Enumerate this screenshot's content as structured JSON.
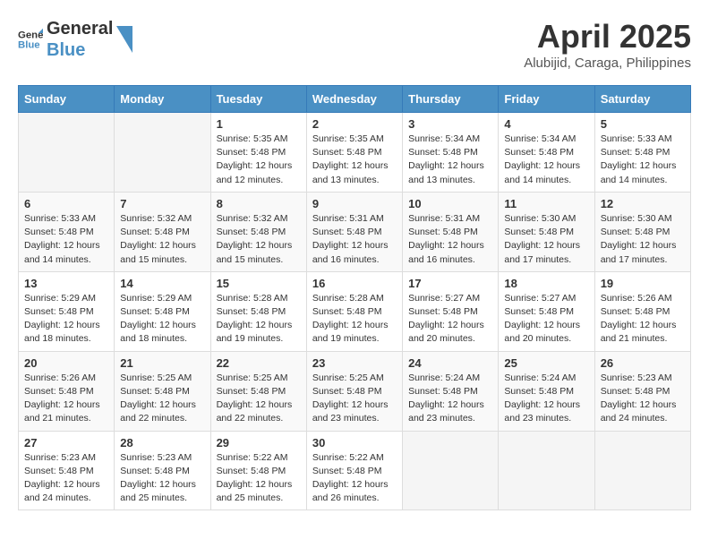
{
  "logo": {
    "line1": "General",
    "line2": "Blue"
  },
  "title": "April 2025",
  "location": "Alubijid, Caraga, Philippines",
  "days_of_week": [
    "Sunday",
    "Monday",
    "Tuesday",
    "Wednesday",
    "Thursday",
    "Friday",
    "Saturday"
  ],
  "weeks": [
    [
      null,
      null,
      {
        "num": "1",
        "sunrise": "5:35 AM",
        "sunset": "5:48 PM",
        "daylight": "12 hours and 12 minutes."
      },
      {
        "num": "2",
        "sunrise": "5:35 AM",
        "sunset": "5:48 PM",
        "daylight": "12 hours and 13 minutes."
      },
      {
        "num": "3",
        "sunrise": "5:34 AM",
        "sunset": "5:48 PM",
        "daylight": "12 hours and 13 minutes."
      },
      {
        "num": "4",
        "sunrise": "5:34 AM",
        "sunset": "5:48 PM",
        "daylight": "12 hours and 14 minutes."
      },
      {
        "num": "5",
        "sunrise": "5:33 AM",
        "sunset": "5:48 PM",
        "daylight": "12 hours and 14 minutes."
      }
    ],
    [
      {
        "num": "6",
        "sunrise": "5:33 AM",
        "sunset": "5:48 PM",
        "daylight": "12 hours and 14 minutes."
      },
      {
        "num": "7",
        "sunrise": "5:32 AM",
        "sunset": "5:48 PM",
        "daylight": "12 hours and 15 minutes."
      },
      {
        "num": "8",
        "sunrise": "5:32 AM",
        "sunset": "5:48 PM",
        "daylight": "12 hours and 15 minutes."
      },
      {
        "num": "9",
        "sunrise": "5:31 AM",
        "sunset": "5:48 PM",
        "daylight": "12 hours and 16 minutes."
      },
      {
        "num": "10",
        "sunrise": "5:31 AM",
        "sunset": "5:48 PM",
        "daylight": "12 hours and 16 minutes."
      },
      {
        "num": "11",
        "sunrise": "5:30 AM",
        "sunset": "5:48 PM",
        "daylight": "12 hours and 17 minutes."
      },
      {
        "num": "12",
        "sunrise": "5:30 AM",
        "sunset": "5:48 PM",
        "daylight": "12 hours and 17 minutes."
      }
    ],
    [
      {
        "num": "13",
        "sunrise": "5:29 AM",
        "sunset": "5:48 PM",
        "daylight": "12 hours and 18 minutes."
      },
      {
        "num": "14",
        "sunrise": "5:29 AM",
        "sunset": "5:48 PM",
        "daylight": "12 hours and 18 minutes."
      },
      {
        "num": "15",
        "sunrise": "5:28 AM",
        "sunset": "5:48 PM",
        "daylight": "12 hours and 19 minutes."
      },
      {
        "num": "16",
        "sunrise": "5:28 AM",
        "sunset": "5:48 PM",
        "daylight": "12 hours and 19 minutes."
      },
      {
        "num": "17",
        "sunrise": "5:27 AM",
        "sunset": "5:48 PM",
        "daylight": "12 hours and 20 minutes."
      },
      {
        "num": "18",
        "sunrise": "5:27 AM",
        "sunset": "5:48 PM",
        "daylight": "12 hours and 20 minutes."
      },
      {
        "num": "19",
        "sunrise": "5:26 AM",
        "sunset": "5:48 PM",
        "daylight": "12 hours and 21 minutes."
      }
    ],
    [
      {
        "num": "20",
        "sunrise": "5:26 AM",
        "sunset": "5:48 PM",
        "daylight": "12 hours and 21 minutes."
      },
      {
        "num": "21",
        "sunrise": "5:25 AM",
        "sunset": "5:48 PM",
        "daylight": "12 hours and 22 minutes."
      },
      {
        "num": "22",
        "sunrise": "5:25 AM",
        "sunset": "5:48 PM",
        "daylight": "12 hours and 22 minutes."
      },
      {
        "num": "23",
        "sunrise": "5:25 AM",
        "sunset": "5:48 PM",
        "daylight": "12 hours and 23 minutes."
      },
      {
        "num": "24",
        "sunrise": "5:24 AM",
        "sunset": "5:48 PM",
        "daylight": "12 hours and 23 minutes."
      },
      {
        "num": "25",
        "sunrise": "5:24 AM",
        "sunset": "5:48 PM",
        "daylight": "12 hours and 23 minutes."
      },
      {
        "num": "26",
        "sunrise": "5:23 AM",
        "sunset": "5:48 PM",
        "daylight": "12 hours and 24 minutes."
      }
    ],
    [
      {
        "num": "27",
        "sunrise": "5:23 AM",
        "sunset": "5:48 PM",
        "daylight": "12 hours and 24 minutes."
      },
      {
        "num": "28",
        "sunrise": "5:23 AM",
        "sunset": "5:48 PM",
        "daylight": "12 hours and 25 minutes."
      },
      {
        "num": "29",
        "sunrise": "5:22 AM",
        "sunset": "5:48 PM",
        "daylight": "12 hours and 25 minutes."
      },
      {
        "num": "30",
        "sunrise": "5:22 AM",
        "sunset": "5:48 PM",
        "daylight": "12 hours and 26 minutes."
      },
      null,
      null,
      null
    ]
  ]
}
